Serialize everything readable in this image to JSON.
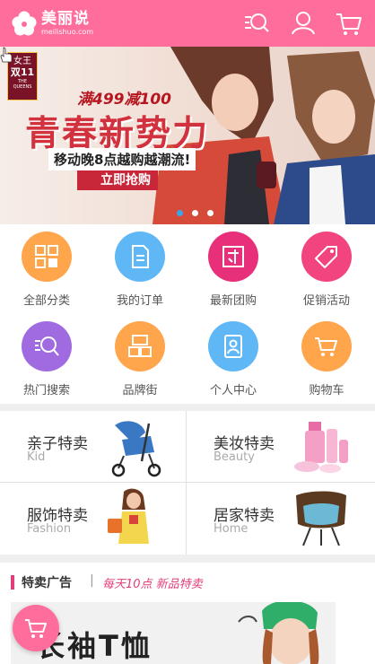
{
  "header": {
    "logo_cn": "美丽说",
    "logo_en": "meilishuo.com",
    "icons": [
      "search-list-icon",
      "user-icon",
      "cart-icon"
    ],
    "brand_color": "#ff6d9c"
  },
  "banner": {
    "badge_line1": "女王",
    "badge_line2": "双11",
    "badge_line3": "THE QUEENS",
    "promo_top": "满499减100",
    "promo_main": "青春新势力",
    "promo_sub": "移动晚8点越购越潮流!",
    "button_label": "立即抢购",
    "slides": 3,
    "active_slide": 1
  },
  "grid": {
    "items": [
      {
        "label": "全部分类",
        "icon": "grid-icon",
        "color": "#ffa64d"
      },
      {
        "label": "我的订单",
        "icon": "order-icon",
        "color": "#5fb8f5"
      },
      {
        "label": "最新团购",
        "icon": "group-buy-icon",
        "color": "#e8307a"
      },
      {
        "label": "促销活动",
        "icon": "tag-icon",
        "color": "#f2457f"
      },
      {
        "label": "热门搜索",
        "icon": "search-icon",
        "color": "#a06be0"
      },
      {
        "label": "品牌街",
        "icon": "brand-icon",
        "color": "#ffa64d"
      },
      {
        "label": "个人中心",
        "icon": "profile-icon",
        "color": "#5fb8f5"
      },
      {
        "label": "购物车",
        "icon": "cart-icon",
        "color": "#ffa64d"
      }
    ]
  },
  "sale": {
    "items": [
      {
        "title": "亲子特卖",
        "subtitle": "Kid"
      },
      {
        "title": "美妆特卖",
        "subtitle": "Beauty"
      },
      {
        "title": "服饰特卖",
        "subtitle": "Fashion"
      },
      {
        "title": "居家特卖",
        "subtitle": "Home"
      }
    ]
  },
  "ads": {
    "title": "特卖广告",
    "separator": "|",
    "tagline": "每天10点 新品特卖",
    "image_text": "长袖T恤"
  }
}
